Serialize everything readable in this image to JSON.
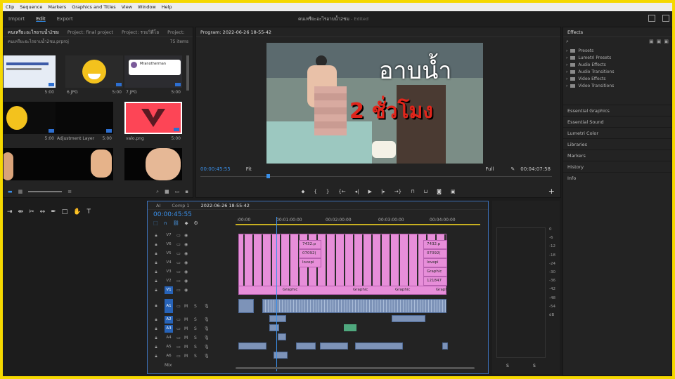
{
  "menu": [
    "Clip",
    "Sequence",
    "Markers",
    "Graphics and Titles",
    "View",
    "Window",
    "Help"
  ],
  "workspace": {
    "tabs": [
      "Import",
      "Edit",
      "Export"
    ],
    "active": "Edit",
    "doc_title": "คนเหรียะอะไรอาบน้ำ2ชม",
    "doc_status": "- Edited"
  },
  "project": {
    "tabs": [
      "คนเหรียะอะไรอาบน้ำ2ชม",
      "Project: final project",
      "Project: รวมวิดีโอ",
      "Project:"
    ],
    "path": "คนเหรียะอะไรอาบน้ำ2ชม.prproj",
    "count": "75 items",
    "items": [
      {
        "name": "",
        "duration": "5:00"
      },
      {
        "name": "6.JPG",
        "duration": "5:00"
      },
      {
        "name": "7.JPG",
        "duration": "5:00"
      },
      {
        "name": "",
        "duration": "5:00"
      },
      {
        "name": "Adjustment Layer",
        "duration": "5:00"
      },
      {
        "name": "valo.png",
        "duration": "5:00"
      },
      {
        "name": "",
        "duration": ""
      },
      {
        "name": "",
        "duration": ""
      },
      {
        "name": "",
        "duration": ""
      }
    ],
    "card_user": "Mranotherman",
    "card_user_1": "..."
  },
  "program": {
    "title": "Program: 2022-06-26 18-55-42",
    "overlay_line1": "อาบน้ำ",
    "overlay_line2": "2 ชั่วโมง",
    "timecode": "00:00:45:55",
    "fit": "Fit",
    "quality": "Full",
    "duration": "00:04:07:58"
  },
  "effects": {
    "title": "Effects",
    "folders": [
      "Presets",
      "Lumetri Presets",
      "Audio Effects",
      "Audio Transitions",
      "Video Effects",
      "Video Transitions"
    ],
    "panels": [
      "Essential Graphics",
      "Essential Sound",
      "Lumetri Color",
      "Libraries",
      "Markers",
      "History",
      "Info"
    ]
  },
  "timeline": {
    "tabs": [
      "AI",
      "Comp 1",
      "2022-06-26 18-55-42"
    ],
    "timecode": "00:00:45:55",
    "ruler": [
      ":00:00",
      "00:01:00:00",
      "00:02:00:00",
      "00:03:00:00",
      "00:04:00:00"
    ],
    "video_tracks": [
      "V7",
      "V6",
      "V5",
      "V4",
      "V3",
      "V2",
      "V1"
    ],
    "audio_tracks": [
      "A1",
      "A2",
      "A3",
      "A4",
      "A5",
      "A6"
    ],
    "clip_labels": [
      "7432.p",
      "07092(",
      "lovepi",
      "Graphic",
      "121847",
      "Graphic",
      "Graphic",
      "Graphic",
      "Graphic"
    ],
    "mix": "Mix"
  },
  "meter": {
    "scale": [
      "0",
      "-6",
      "-12",
      "-18",
      "-24",
      "-30",
      "-36",
      "-42",
      "-48",
      "-54",
      "dB"
    ],
    "solo": [
      "S",
      "S"
    ]
  },
  "colors": {
    "accent": "#2d8ceb",
    "video_clip": "#e78ed9",
    "audio_clip": "#7d93b8",
    "frame": "#f5d800"
  }
}
